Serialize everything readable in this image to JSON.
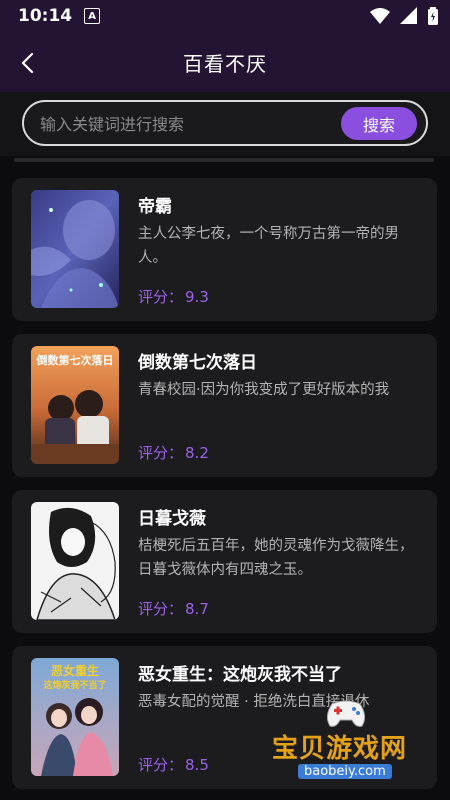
{
  "status_bar": {
    "time": "10:14",
    "notification_badge": "A"
  },
  "header": {
    "title": "百看不厌"
  },
  "search": {
    "placeholder": "输入关键词进行搜索",
    "button_label": "搜索"
  },
  "score_label": "评分：",
  "books": [
    {
      "title": "帝霸",
      "description": "主人公李七夜，一个号称万古第一帝的男人。",
      "score": "9.3"
    },
    {
      "title": "倒数第七次落日",
      "description": "青春校园·因为你我变成了更好版本的我",
      "score": "8.2",
      "cover_text": "倒数第七次落日"
    },
    {
      "title": "日暮戈薇",
      "description": "桔梗死后五百年，她的灵魂作为戈薇降生，日暮戈薇体内有四魂之玉。",
      "score": "8.7"
    },
    {
      "title": "恶女重生：这炮灰我不当了",
      "description": "恶毒女配的觉醒 · 拒绝洗白直接退休",
      "score": "8.5",
      "cover_text_line1": "恶女重生",
      "cover_text_line2": "这炮灰我不当了"
    }
  ],
  "watermark": {
    "name": "宝贝游戏网",
    "url": "baobeiy.com"
  },
  "colors": {
    "header_bg": "#241433",
    "accent": "#8b4fe0",
    "score": "#9a62e8",
    "card_bg": "#1c1c1e"
  }
}
